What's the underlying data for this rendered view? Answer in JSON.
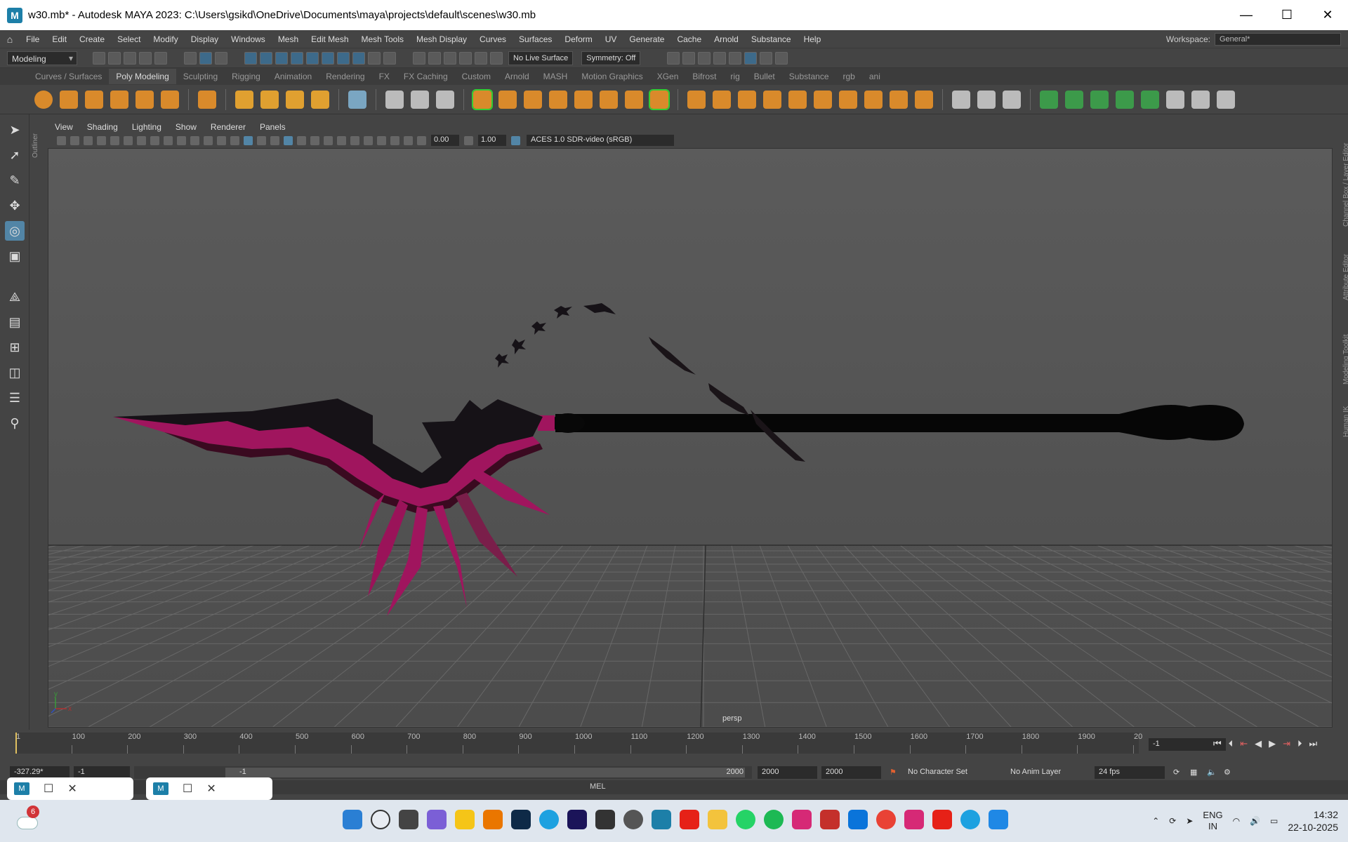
{
  "window": {
    "title": "w30.mb* - Autodesk MAYA 2023: C:\\Users\\gsikd\\OneDrive\\Documents\\maya\\projects\\default\\scenes\\w30.mb",
    "app_icon_letter": "M",
    "minimize": "—",
    "maximize": "☐",
    "close": "✕"
  },
  "menubar": {
    "items": [
      "File",
      "Edit",
      "Create",
      "Select",
      "Modify",
      "Display",
      "Windows",
      "Mesh",
      "Edit Mesh",
      "Mesh Tools",
      "Mesh Display",
      "Curves",
      "Surfaces",
      "Deform",
      "UV",
      "Generate",
      "Cache",
      "Arnold",
      "Substance",
      "Help"
    ],
    "workspace_label": "Workspace:",
    "workspace_value": "General*"
  },
  "statusline": {
    "mode": "Modeling",
    "live_surface": "No Live Surface",
    "symmetry": "Symmetry: Off"
  },
  "shelf": {
    "tabs": [
      "Curves / Surfaces",
      "Poly Modeling",
      "Sculpting",
      "Rigging",
      "Animation",
      "Rendering",
      "FX",
      "FX Caching",
      "Custom",
      "Arnold",
      "MASH",
      "Motion Graphics",
      "XGen",
      "Bifrost",
      "rig",
      "Bullet",
      "Substance",
      "rgb",
      "ani"
    ],
    "active_tab": "Poly Modeling"
  },
  "outliner_label": "Outliner",
  "panel_menu": [
    "View",
    "Shading",
    "Lighting",
    "Show",
    "Renderer",
    "Panels"
  ],
  "viewport_toolbar": {
    "exposure": "0.00",
    "gamma": "1.00",
    "color_space": "ACES 1.0 SDR-video (sRGB)"
  },
  "viewport": {
    "camera": "persp",
    "axis_y": "y",
    "axis_x": "x"
  },
  "right_tabs": [
    "Channel Box / Layer Editor",
    "Attribute Editor",
    "Modeling Toolkit",
    "Human IK"
  ],
  "timeslider": {
    "ticks": [
      "1",
      "100",
      "200",
      "300",
      "400",
      "500",
      "600",
      "700",
      "800",
      "900",
      "1000",
      "1100",
      "1200",
      "1300",
      "1400",
      "1500",
      "1600",
      "1700",
      "1800",
      "1900",
      "20"
    ],
    "current_frame": "-1"
  },
  "range": {
    "field1": "-327.29*",
    "start": "-1",
    "range_start_label": "-1",
    "range_end_label": "2000",
    "end": "2000",
    "anim_end": "2000",
    "character_set": "No Character Set",
    "anim_layer": "No Anim Layer",
    "fps": "24 fps"
  },
  "cmdline": {
    "label": "MEL"
  },
  "taskbar": {
    "notification_count": "6",
    "lang_top": "ENG",
    "lang_bottom": "IN",
    "time": "14:32",
    "date": "22-10-2025"
  },
  "colors": {
    "accent": "#5285a6",
    "blade_magenta": "#a0155e",
    "blade_dark": "#1a1418"
  }
}
